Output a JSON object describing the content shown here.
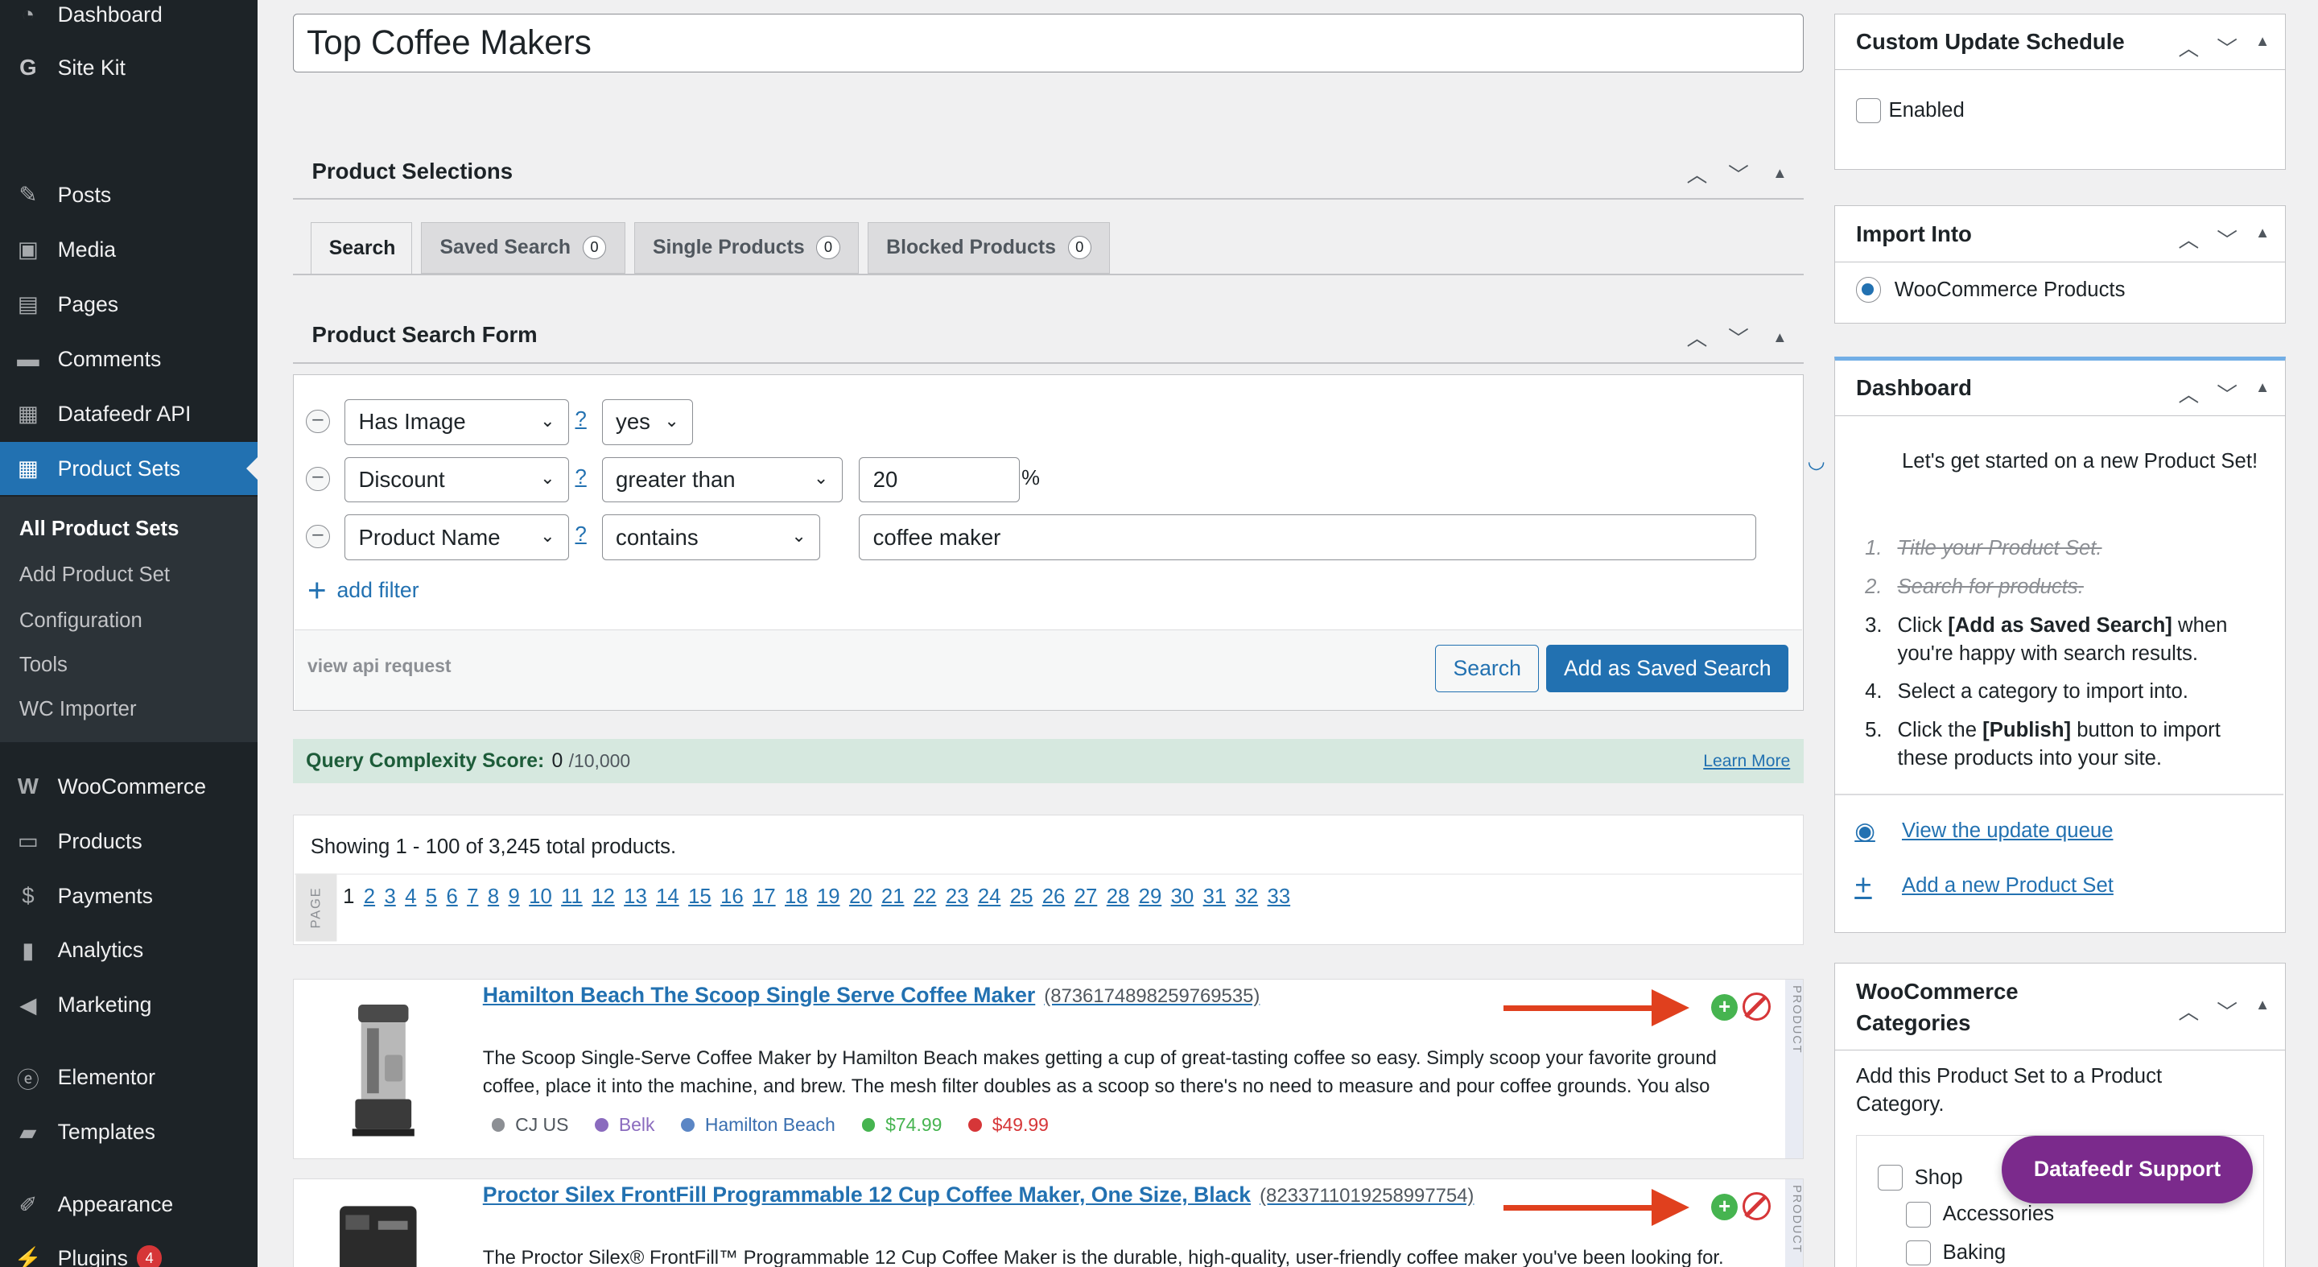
{
  "sidebar": {
    "dashboard": "Dashboard",
    "site_kit": "Site Kit",
    "posts": "Posts",
    "media": "Media",
    "pages": "Pages",
    "comments": "Comments",
    "datafeedr_api": "Datafeedr API",
    "product_sets": "Product Sets",
    "submenu": [
      "All Product Sets",
      "Add Product Set",
      "Configuration",
      "Tools",
      "WC Importer"
    ],
    "woocommerce": "WooCommerce",
    "products": "Products",
    "payments": "Payments",
    "analytics": "Analytics",
    "marketing": "Marketing",
    "elementor": "Elementor",
    "templates": "Templates",
    "appearance": "Appearance",
    "plugins": "Plugins",
    "plugins_badge": "4"
  },
  "title_value": "Top Coffee Makers",
  "product_selections": {
    "heading": "Product Selections",
    "tabs": [
      {
        "label": "Search",
        "count": ""
      },
      {
        "label": "Saved Search",
        "count": "0"
      },
      {
        "label": "Single Products",
        "count": "0"
      },
      {
        "label": "Blocked Products",
        "count": "0"
      }
    ]
  },
  "search_form": {
    "heading": "Product Search Form",
    "filters": [
      {
        "field": "Has Image",
        "help": "?",
        "operator": "yes",
        "value": ""
      },
      {
        "field": "Discount",
        "help": "?",
        "operator": "greater than",
        "value": "20",
        "suffix": "%"
      },
      {
        "field": "Product Name",
        "help": "?",
        "operator": "contains",
        "value": "coffee maker"
      }
    ],
    "add_filter": "add filter",
    "view_api": "view api request",
    "search_btn": "Search",
    "save_btn": "Add as Saved Search"
  },
  "query": {
    "label": "Query Complexity Score:",
    "score": "0",
    "max": "/10,000",
    "learn_more": "Learn More"
  },
  "results": {
    "showing": "Showing 1 - 100 of 3,245 total products.",
    "page_label": "PAGE",
    "current_page": "1",
    "pages": [
      "2",
      "3",
      "4",
      "5",
      "6",
      "7",
      "8",
      "9",
      "10",
      "11",
      "12",
      "13",
      "14",
      "15",
      "16",
      "17",
      "18",
      "19",
      "20",
      "21",
      "22",
      "23",
      "24",
      "25",
      "26",
      "27",
      "28",
      "29",
      "30",
      "31",
      "32",
      "33"
    ]
  },
  "products": [
    {
      "title": "Hamilton Beach The Scoop Single Serve Coffee Maker",
      "id": "(8736174898259769535)",
      "desc": "The Scoop Single-Serve Coffee Maker by Hamilton Beach makes getting a cup of great-tasting coffee so easy. Simply scoop your favorite ground coffee, place it into the machine, and brew. The mesh filter doubles as a scoop so there's no need to measure and pour coffee grounds. You also",
      "network": "CJ US",
      "merchant": "Belk",
      "brand": "Hamilton Beach",
      "price": "$74.99",
      "sale": "$49.99",
      "strip": "PRODUCT"
    },
    {
      "title": "Proctor Silex FrontFill Programmable 12 Cup Coffee Maker, One Size, Black",
      "id": "(8233711019258997754)",
      "desc": "The Proctor Silex® FrontFill™ Programmable 12 Cup Coffee Maker is the durable, high-quality, user-friendly coffee maker you've been looking for.",
      "strip": "PRODUCT"
    }
  ],
  "right": {
    "schedule": {
      "heading": "Custom Update Schedule",
      "enabled": "Enabled"
    },
    "import_into": {
      "heading": "Import Into",
      "option": "WooCommerce Products"
    },
    "dashboard": {
      "heading": "Dashboard",
      "intro": "Let's get started on a new Product Set!",
      "steps": [
        {
          "n": "1.",
          "text": "Title your Product Set.",
          "done": true
        },
        {
          "n": "2.",
          "text": "Search for products.",
          "done": true
        },
        {
          "n": "3.",
          "pre": "Click ",
          "bold": "[Add as Saved Search]",
          "post": " when you're happy with search results.",
          "done": false
        },
        {
          "n": "4.",
          "text": "Select a category to import into.",
          "done": false
        },
        {
          "n": "5.",
          "pre": "Click the ",
          "bold": "[Publish]",
          "post": " button to import these products into your site.",
          "done": false
        }
      ],
      "view_queue": "View the update queue",
      "add_new": "Add a new Product Set"
    },
    "categories": {
      "heading_line1": "WooCommerce",
      "heading_line2": "Categories",
      "desc": "Add this Product Set to a Product Category.",
      "items": [
        "Shop",
        "Accessories",
        "Baking"
      ]
    },
    "support": "Datafeedr Support"
  },
  "colors": {
    "accent": "#2271b1",
    "sidebar": "#1d2327",
    "support": "#7b2a8c",
    "arrow": "#e0401e",
    "price": "#46b450",
    "sale": "#d63638"
  }
}
